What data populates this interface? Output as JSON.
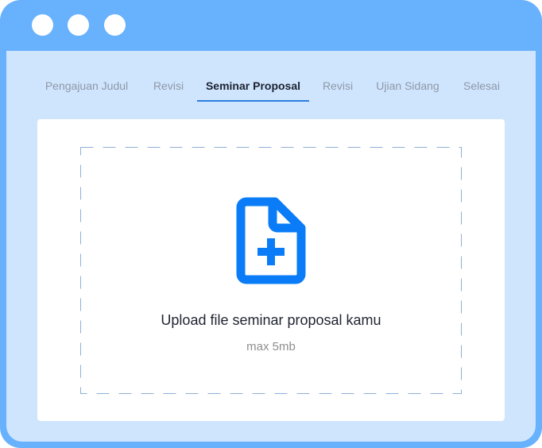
{
  "window": {
    "controls": [
      "dot",
      "dot",
      "dot"
    ]
  },
  "tabs": [
    {
      "label": "Pengajuan Judul",
      "active": false
    },
    {
      "label": "Revisi",
      "active": false
    },
    {
      "label": "Seminar Proposal",
      "active": true
    },
    {
      "label": "Revisi",
      "active": false
    },
    {
      "label": "Ujian Sidang",
      "active": false
    },
    {
      "label": "Selesai",
      "active": false
    }
  ],
  "upload": {
    "icon": "file-plus-icon",
    "title": "Upload file seminar proposal kamu",
    "subtitle": "max 5mb"
  },
  "colors": {
    "frame": "#67b1fd",
    "content_bg": "#cfe5fe",
    "accent": "#0a7cf7",
    "active_tab_underline": "#2c7de0"
  }
}
